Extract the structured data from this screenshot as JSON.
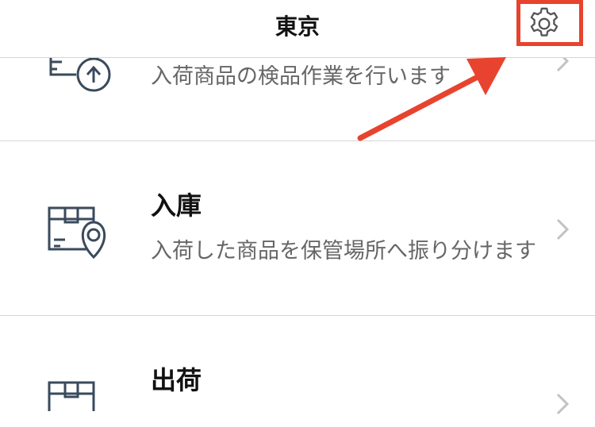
{
  "header": {
    "title": "東京",
    "settings_icon": "gear-icon"
  },
  "rows": [
    {
      "title": "",
      "description": "入荷商品の検品作業を行います",
      "icon": "inspection-upload-icon"
    },
    {
      "title": "入庫",
      "description": "入荷した商品を保管場所へ振り分けます",
      "icon": "box-location-pin-icon"
    },
    {
      "title": "出荷",
      "description": "",
      "icon": "box-shipping-icon"
    }
  ],
  "colors": {
    "annotation": "#e8432e",
    "icon_stroke": "#3a4a5c",
    "text_secondary": "#666666",
    "divider": "#d6d6d6"
  }
}
